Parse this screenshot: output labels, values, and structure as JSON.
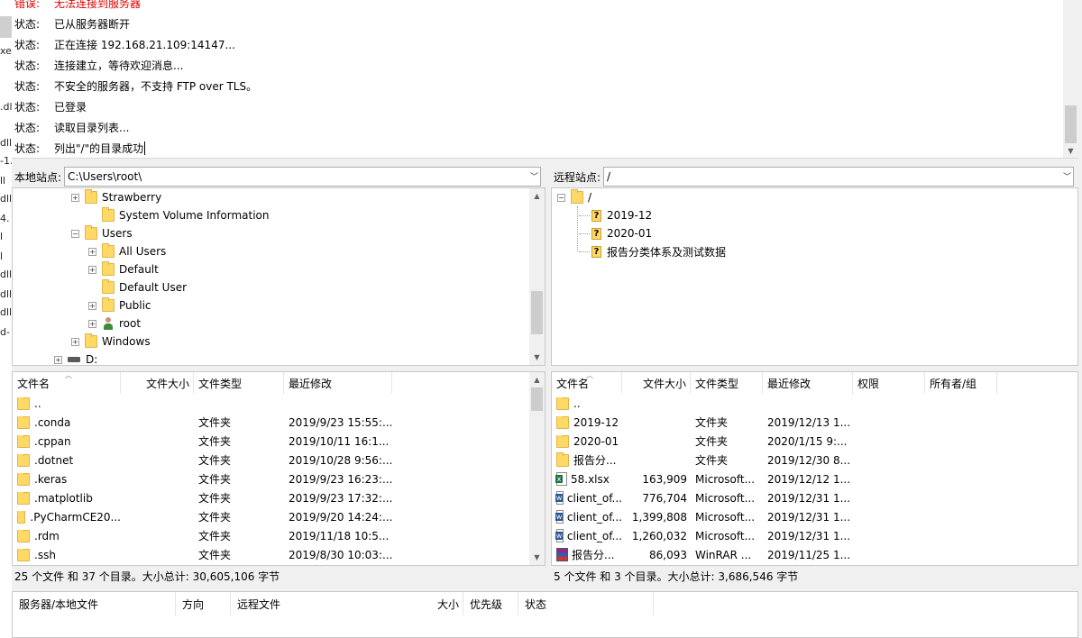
{
  "left_fragments": [
    "xe",
    ".dl",
    "dll",
    "-1.",
    "ll",
    "dll",
    "4.",
    "l",
    "l",
    "dll",
    "dll",
    "dll",
    "d-"
  ],
  "log": {
    "first_line": {
      "label": "错误:",
      "text": "无法连接到服务器"
    },
    "lines": [
      {
        "label": "状态:",
        "text": "已从服务器断开"
      },
      {
        "label": "状态:",
        "text": "正在连接 192.168.21.109:14147..."
      },
      {
        "label": "状态:",
        "text": "连接建立，等待欢迎消息..."
      },
      {
        "label": "状态:",
        "text": "不安全的服务器，不支持 FTP over TLS。"
      },
      {
        "label": "状态:",
        "text": "已登录"
      },
      {
        "label": "状态:",
        "text": "读取目录列表..."
      },
      {
        "label": "状态:",
        "text": "列出\"/\"的目录成功"
      }
    ]
  },
  "local": {
    "site_label": "本地站点:",
    "path": "C:\\Users\\root\\",
    "tree": [
      {
        "label": "Strawberry",
        "toggle": "+"
      },
      {
        "label": "System Volume Information",
        "toggle": ""
      },
      {
        "label": "Users",
        "toggle": "-"
      },
      {
        "label": "All Users",
        "toggle": "+"
      },
      {
        "label": "Default",
        "toggle": "+"
      },
      {
        "label": "Default User",
        "toggle": ""
      },
      {
        "label": "Public",
        "toggle": "+"
      },
      {
        "label": "root",
        "toggle": "+"
      },
      {
        "label": "Windows",
        "toggle": "+"
      },
      {
        "label": "D:",
        "toggle": "+"
      }
    ],
    "columns": [
      "文件名",
      "文件大小",
      "文件类型",
      "最近修改"
    ],
    "files": [
      {
        "name": "..",
        "size": "",
        "type": "",
        "modified": ""
      },
      {
        "name": ".conda",
        "size": "",
        "type": "文件夹",
        "modified": "2019/9/23 15:55:..."
      },
      {
        "name": ".cppan",
        "size": "",
        "type": "文件夹",
        "modified": "2019/10/11 16:1..."
      },
      {
        "name": ".dotnet",
        "size": "",
        "type": "文件夹",
        "modified": "2019/10/28 9:56:..."
      },
      {
        "name": ".keras",
        "size": "",
        "type": "文件夹",
        "modified": "2019/9/23 16:23:..."
      },
      {
        "name": ".matplotlib",
        "size": "",
        "type": "文件夹",
        "modified": "2019/9/23 17:32:..."
      },
      {
        "name": ".PyCharmCE20...",
        "size": "",
        "type": "文件夹",
        "modified": "2019/9/20 14:24:..."
      },
      {
        "name": ".rdm",
        "size": "",
        "type": "文件夹",
        "modified": "2019/11/18 10:5..."
      },
      {
        "name": ".ssh",
        "size": "",
        "type": "文件夹",
        "modified": "2019/8/30 10:03:..."
      }
    ],
    "status": "25 个文件 和 37 个目录。大小总计: 30,605,106 字节"
  },
  "remote": {
    "site_label": "远程站点:",
    "path": "/",
    "tree": [
      {
        "label": "/",
        "toggle": "-"
      },
      {
        "label": "2019-12",
        "toggle": ""
      },
      {
        "label": "2020-01",
        "toggle": ""
      },
      {
        "label": "报告分类体系及测试数据",
        "toggle": ""
      }
    ],
    "columns": [
      "文件名",
      "文件大小",
      "文件类型",
      "最近修改",
      "权限",
      "所有者/组"
    ],
    "files": [
      {
        "name": "..",
        "icon": "folder",
        "size": "",
        "type": "",
        "modified": ""
      },
      {
        "name": "2019-12",
        "icon": "folder",
        "size": "",
        "type": "文件夹",
        "modified": "2019/12/13 1..."
      },
      {
        "name": "2020-01",
        "icon": "folder",
        "size": "",
        "type": "文件夹",
        "modified": "2020/1/15 9:..."
      },
      {
        "name": "报告分...",
        "icon": "folder",
        "size": "",
        "type": "文件夹",
        "modified": "2019/12/30 8..."
      },
      {
        "name": "58.xlsx",
        "icon": "xls",
        "size": "163,909",
        "type": "Microsoft...",
        "modified": "2019/12/12 1..."
      },
      {
        "name": "client_of...",
        "icon": "doc",
        "size": "776,704",
        "type": "Microsoft...",
        "modified": "2019/12/31 1..."
      },
      {
        "name": "client_of...",
        "icon": "doc",
        "size": "1,399,808",
        "type": "Microsoft...",
        "modified": "2019/12/31 1..."
      },
      {
        "name": "client_of...",
        "icon": "doc",
        "size": "1,260,032",
        "type": "Microsoft...",
        "modified": "2019/12/31 1..."
      },
      {
        "name": "报告分...",
        "icon": "rar",
        "size": "86,093",
        "type": "WinRAR ...",
        "modified": "2019/11/25 1..."
      }
    ],
    "status": "5 个文件 和 3 个目录。大小总计: 3,686,546 字节"
  },
  "queue": {
    "columns": [
      "服务器/本地文件",
      "方向",
      "远程文件",
      "大小",
      "优先级",
      "状态"
    ]
  }
}
